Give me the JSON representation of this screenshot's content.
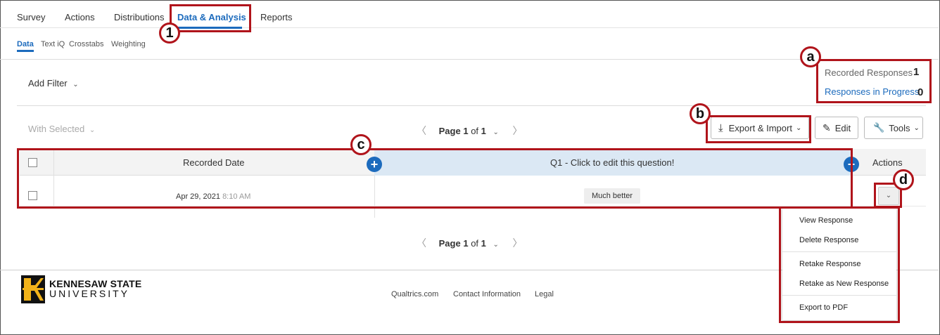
{
  "nav": {
    "tabs": [
      "Survey",
      "Actions",
      "Distributions",
      "Data & Analysis",
      "Reports"
    ],
    "active": "Data & Analysis"
  },
  "subnav": {
    "tabs": [
      "Data",
      "Text iQ",
      "Crosstabs",
      "Weighting"
    ],
    "active": "Data"
  },
  "filter": {
    "add_label": "Add Filter"
  },
  "responses": {
    "recorded_label": "Recorded Responses",
    "recorded_value": "1",
    "in_progress_label": "Responses in Progress",
    "in_progress_value": "0"
  },
  "toolbar": {
    "with_selected": "With Selected",
    "export_import": "Export & Import",
    "edit": "Edit",
    "tools": "Tools"
  },
  "pager": {
    "page_word": "Page",
    "page": "1",
    "of_word": "of",
    "total": "1"
  },
  "table": {
    "headers": {
      "date": "Recorded Date",
      "q1": "Q1 - Click to edit this question!",
      "actions": "Actions"
    },
    "rows": [
      {
        "date": "Apr 29, 2021",
        "time": "8:10 AM",
        "q1": "Much better"
      }
    ]
  },
  "menu": {
    "items": [
      "View Response",
      "Delete Response",
      "Retake Response",
      "Retake as New Response",
      "Export to PDF"
    ]
  },
  "footer": {
    "logo_line1": "KENNESAW STATE",
    "logo_line2": "UNIVERSITY",
    "links": [
      "Qualtrics.com",
      "Contact Information",
      "Legal"
    ]
  },
  "annotations": {
    "one": "1",
    "a": "a",
    "b": "b",
    "c": "c",
    "d": "d"
  },
  "colors": {
    "accent": "#1c6bbd",
    "annotation_red": "#b0141b",
    "logo_gold": "#f2b31a"
  }
}
